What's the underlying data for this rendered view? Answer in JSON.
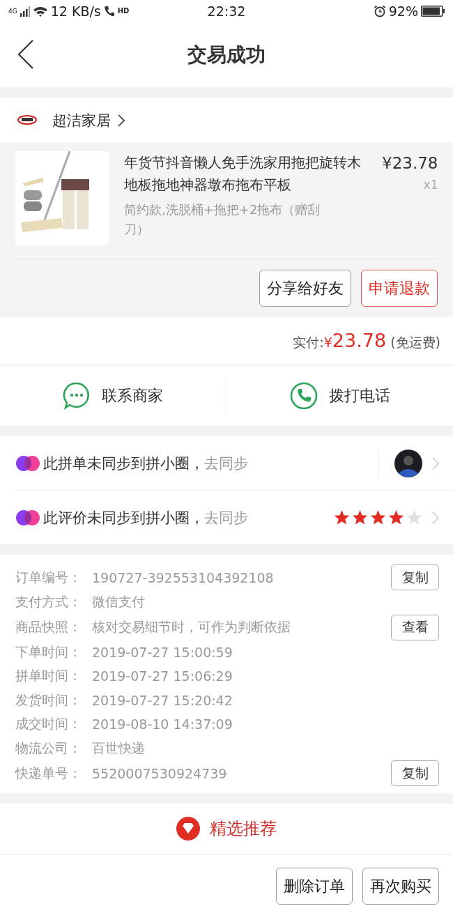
{
  "status_bar": {
    "network": "4G",
    "speed": "12 KB/s",
    "call_badge": "HD",
    "time": "22:32",
    "battery": "92%"
  },
  "header": {
    "title": "交易成功"
  },
  "shop": {
    "name": "超洁家居"
  },
  "product": {
    "kind": "picture",
    "title": "年货节抖音懒人免手洗家用拖把旋转木地板拖地神器墩布拖布平板",
    "variant": "简约款,洗脱桶+拖把+2拖布（赠刮刀）",
    "price": "¥23.78",
    "quantity": "x1"
  },
  "product_actions": [
    {
      "label": "分享给好友",
      "kind": "normal"
    },
    {
      "label": "申请退款",
      "kind": "accent"
    }
  ],
  "payment": {
    "label": "实付:",
    "currency": "¥",
    "amount": "23.78",
    "note": "(免运费)"
  },
  "contact": [
    {
      "label": "联系商家",
      "kind": "chat"
    },
    {
      "label": "拨打电话",
      "kind": "phone"
    }
  ],
  "sync_rows": [
    {
      "text": "此拼单未同步到拼小圈，",
      "link": "去同步",
      "kind": "avatar"
    },
    {
      "text": "此评价未同步到拼小圈，",
      "link": "去同步",
      "kind": "stars",
      "stars": 4
    }
  ],
  "order_info": [
    {
      "label": "订单编号：",
      "value": "190727-392553104392108",
      "button": "复制"
    },
    {
      "label": "支付方式：",
      "value": "微信支付"
    },
    {
      "label": "商品快照：",
      "value": "核对交易细节时，可作为判断依据",
      "button": "查看"
    },
    {
      "label": "下单时间：",
      "value": "2019-07-27 15:00:59"
    },
    {
      "label": "拼单时间：",
      "value": "2019-07-27 15:06:29"
    },
    {
      "label": "发货时间：",
      "value": "2019-07-27 15:20:42"
    },
    {
      "label": "成交时间：",
      "value": "2019-08-10 14:37:09"
    },
    {
      "label": "物流公司：",
      "value": "百世快递"
    },
    {
      "label": "快递单号：",
      "value": "5520007530924739",
      "button": "复制"
    }
  ],
  "recommend": {
    "title": "精选推荐"
  },
  "bottom_actions": [
    {
      "label": "删除订单"
    },
    {
      "label": "再次购买"
    }
  ]
}
